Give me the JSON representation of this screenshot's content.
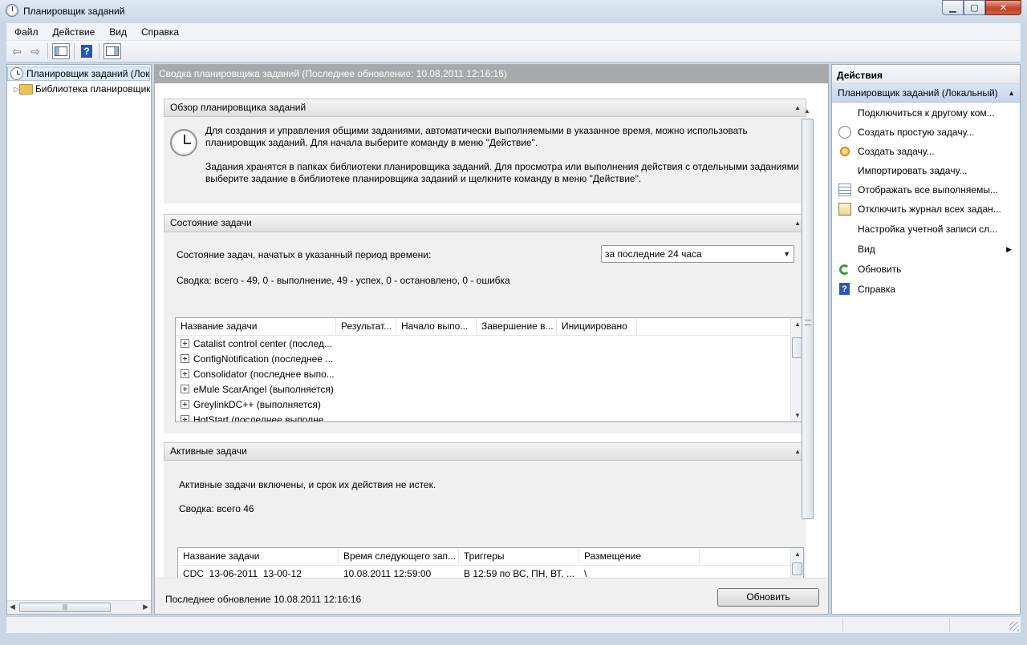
{
  "window": {
    "title": "Планировщик заданий"
  },
  "menu": [
    "Файл",
    "Действие",
    "Вид",
    "Справка"
  ],
  "toolbar": {
    "help_glyph": "?"
  },
  "tree": {
    "root": "Планировщик заданий (Локальный)",
    "library": "Библиотека планировщика заданий"
  },
  "center": {
    "header": "Сводка планировщика заданий (Последнее обновление: 10.08.2011 12:16:16)",
    "overview": {
      "title": "Обзор планировщика заданий",
      "para1_line1": "Для создания и управления общими заданиями, автоматически выполняемыми в указанное время, можно использовать",
      "para1_line2": "планировщик заданий. Для начала выберите команду в меню \"Действие\".",
      "para2_line1": "Задания хранятся в папках библиотеки планировщика заданий. Для просмотра или выполнения действия с отдельными заданиями",
      "para2_line2": "выберите задание в библиотеке планировщика заданий и щелкните команду в меню \"Действие\"."
    },
    "status": {
      "title": "Состояние задачи",
      "period_label": "Состояние задач, начатых в указанный период времени:",
      "period_value": "за последние 24 часа",
      "summary": "Сводка: всего - 49, 0 - выполнение, 49 - успех, 0 - остановлено, 0 - ошибка",
      "columns": [
        "Название задачи",
        "Результат...",
        "Начало выпо...",
        "Завершение в...",
        "Инициировано"
      ],
      "rows": [
        "Catalist control center (послед...",
        "ConfigNotification (последнее ...",
        "Consolidator (последнее выпо...",
        "eMule ScarAngel (выполняется)",
        "GreylinkDC++ (выполняется)",
        "HotStart (последнее выполне..."
      ]
    },
    "active": {
      "title": "Активные задачи",
      "line1": "Активные задачи включены, и срок их действия не истек.",
      "summary": "Сводка: всего 46",
      "columns": [
        "Название задачи",
        "Время следующего зап...",
        "Триггеры",
        "Размещение"
      ],
      "rows": [
        {
          "name": "CDC_13-06-2011_13-00-12",
          "next": "10.08.2011 12:59:00",
          "trigger": "В 12:59 по ВС, ПН, ВТ, ...",
          "place": "\\"
        }
      ]
    },
    "footer": {
      "last_update": "Последнее обновление 10.08.2011 12:16:16",
      "refresh": "Обновить"
    }
  },
  "actions": {
    "title": "Действия",
    "group": "Планировщик заданий (Локальный)",
    "items": [
      {
        "label": "Подключиться к другому ком...",
        "icon": "none"
      },
      {
        "label": "Создать простую задачу...",
        "icon": "clock-icon"
      },
      {
        "label": "Создать задачу...",
        "icon": "wizard-icon"
      },
      {
        "label": "Импортировать задачу...",
        "icon": "none"
      },
      {
        "label": "Отображать все выполняемы...",
        "icon": "list-icon"
      },
      {
        "label": "Отключить журнал всех задан...",
        "icon": "log-icon"
      },
      {
        "label": "Настройка учетной записи сл...",
        "icon": "none"
      },
      {
        "label": "Вид",
        "icon": "none"
      },
      {
        "label": "Обновить",
        "icon": "refresh-icon"
      },
      {
        "label": "Справка",
        "icon": "help-icon"
      }
    ]
  }
}
